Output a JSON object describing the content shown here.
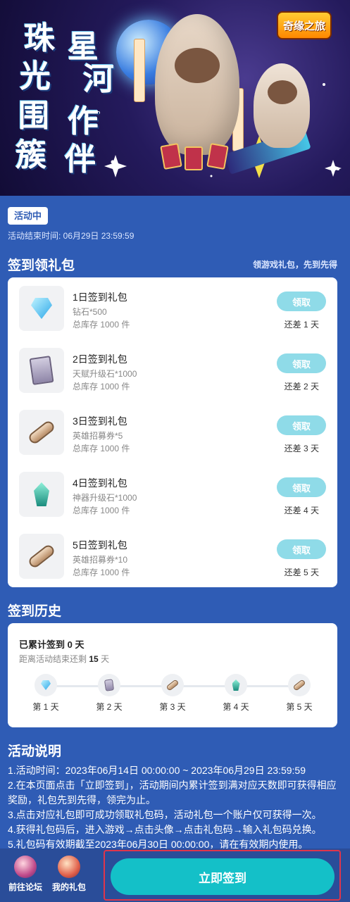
{
  "banner": {
    "title_chars": [
      "珠",
      "光",
      "星",
      "河",
      "围",
      "簇",
      "作",
      "伴"
    ],
    "logo": "奇缘之旅"
  },
  "status": {
    "badge": "活动中",
    "end_time": "活动结束时间: 06月29日 23:59:59"
  },
  "signin_gifts": {
    "title": "签到领礼包",
    "subtitle": "领游戏礼包，先到先得",
    "items": [
      {
        "name": "1日签到礼包",
        "desc": "钻石*500",
        "stock": "总库存 1000 件",
        "button": "领取",
        "days_left": "还差 1 天",
        "icon": "diamond-icon"
      },
      {
        "name": "2日签到礼包",
        "desc": "天赋升级石*1000",
        "stock": "总库存 1000 件",
        "button": "领取",
        "days_left": "还差 2 天",
        "icon": "talent-book-icon"
      },
      {
        "name": "3日签到礼包",
        "desc": "英雄招募券*5",
        "stock": "总库存 1000 件",
        "button": "领取",
        "days_left": "还差 3 天",
        "icon": "scroll-icon"
      },
      {
        "name": "4日签到礼包",
        "desc": "神器升级石*1000",
        "stock": "总库存 1000 件",
        "button": "领取",
        "days_left": "还差 4 天",
        "icon": "crystal-icon"
      },
      {
        "name": "5日签到礼包",
        "desc": "英雄招募券*10",
        "stock": "总库存 1000 件",
        "button": "领取",
        "days_left": "还差 5 天",
        "icon": "scroll-icon"
      }
    ]
  },
  "history": {
    "title": "签到历史",
    "total_prefix": "已累计签到",
    "total_days": "0",
    "total_suffix": "天",
    "remain_prefix": "距离活动结束还剩",
    "remain_days": "15",
    "remain_suffix": "天",
    "days": [
      "第 1 天",
      "第 2 天",
      "第 3 天",
      "第 4 天",
      "第 5 天"
    ]
  },
  "description": {
    "title": "活动说明",
    "lines": [
      "1.活动时间：2023年06月14日 00:00:00 ~ 2023年06月29日 23:59:59",
      "2.在本页面点击「立即签到」，活动期间内累计签到满对应天数即可获得相应奖励，礼包先到先得，领完为止。",
      "3.点击对应礼包即可成功领取礼包码，活动礼包一个账户仅可获得一次。",
      "4.获得礼包码后，进入游戏→点击头像→点击礼包码→输入礼包码兑换。",
      "5.礼包码有效期截至2023年06月30日 00:00:00，请在有效期内使用。"
    ]
  },
  "bottom_nav": {
    "forum": "前往论坛",
    "my_gifts": "我的礼包",
    "checkin": "立即签到"
  }
}
